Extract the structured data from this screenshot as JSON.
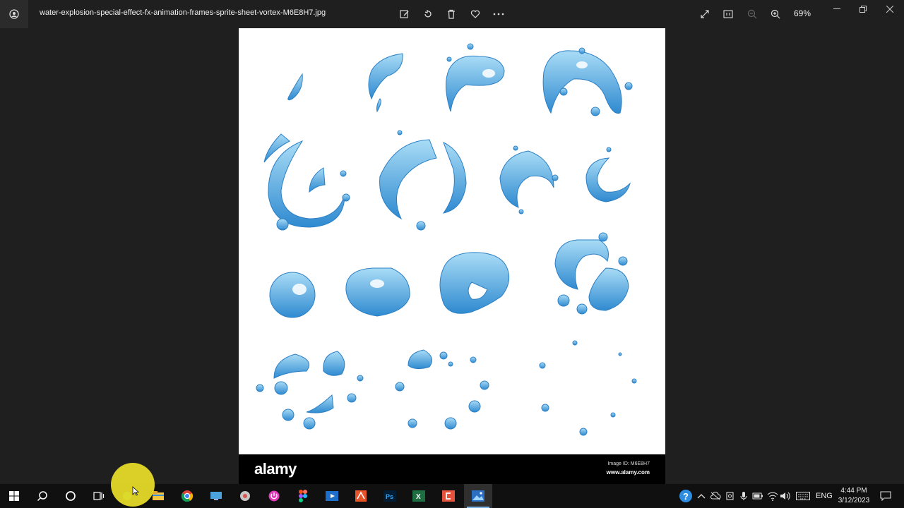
{
  "window": {
    "filename": "water-explosion-special-effect-fx-animation-frames-sprite-sheet-vortex-M6E8H7.jpg",
    "zoom": "69%"
  },
  "toolbar": {
    "actions": [
      "edit-image-icon",
      "rotate-icon",
      "delete-icon",
      "favorite-icon",
      "more-icon"
    ],
    "view_actions": [
      "fullscreen-icon",
      "actual-size-icon",
      "zoom-out-icon",
      "zoom-in-icon"
    ]
  },
  "image": {
    "brand": "alamy",
    "image_id": "Image ID: M6E8H7",
    "site": "www.alamy.com"
  },
  "taskbar": {
    "apps": [
      "start-icon",
      "search-icon",
      "cortana-icon",
      "task-view-icon",
      "file-explorer-icon",
      "chrome-icon",
      "app-icon",
      "app-icon",
      "app-icon",
      "figma-icon",
      "app-icon",
      "app-icon",
      "photoshop-icon",
      "excel-icon",
      "app-icon",
      "photos-icon"
    ],
    "language": "ENG",
    "time": "4:44 PM",
    "date": "3/12/2023"
  },
  "colors": {
    "water_light": "#7cc6ee",
    "water_dark": "#2f8ad0",
    "highlight": "#eae028"
  }
}
